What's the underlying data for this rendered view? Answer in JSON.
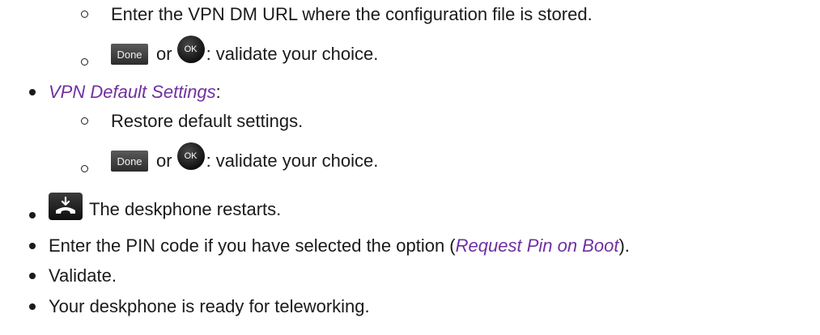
{
  "items": [
    {
      "type": "sub",
      "text": "Enter the VPN DM URL where the configuration file is stored."
    },
    {
      "type": "sub-validate",
      "done_label": "Done",
      "or_text": "or",
      "ok_label": "OK",
      "suffix": ": validate your choice."
    },
    {
      "type": "bullet-em",
      "em_text": "VPN Default Settings",
      "suffix": ":"
    },
    {
      "type": "sub",
      "text": "Restore default settings."
    },
    {
      "type": "sub-validate",
      "done_label": "Done",
      "or_text": "or",
      "ok_label": "OK",
      "suffix": ": validate your choice."
    },
    {
      "type": "bullet-icon",
      "icon": "handset-down-icon",
      "text": "The deskphone restarts."
    },
    {
      "type": "bullet-mixed",
      "prefix": "Enter the PIN code if you have selected the option (",
      "em_text": "Request Pin on Boot",
      "suffix": ")."
    },
    {
      "type": "bullet",
      "text": "Validate."
    },
    {
      "type": "bullet",
      "text": "Your deskphone is ready for teleworking."
    }
  ]
}
